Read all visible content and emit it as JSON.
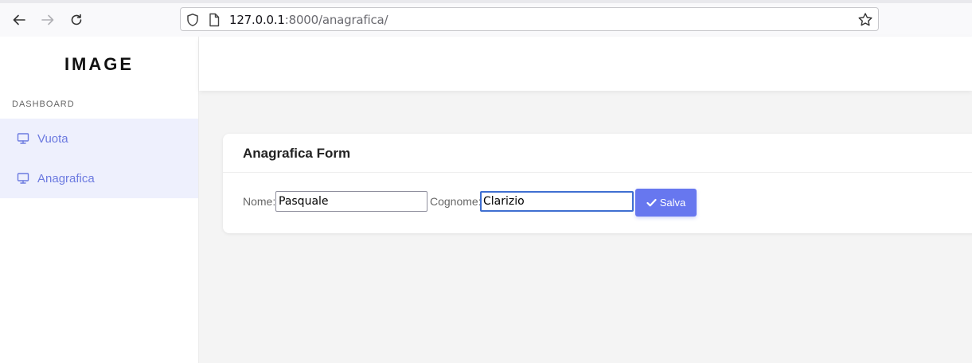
{
  "browser": {
    "url_host": "127.0.0.1",
    "url_rest": ":8000/anagrafica/"
  },
  "sidebar": {
    "brand": "IMAGE",
    "section_title": "DASHBOARD",
    "items": [
      {
        "label": "Vuota",
        "icon": "monitor-icon"
      },
      {
        "label": "Anagrafica",
        "icon": "monitor-icon"
      }
    ]
  },
  "form": {
    "title": "Anagrafica Form",
    "nome_label": "Nome:",
    "nome_value": "Pasquale",
    "cognome_label": "Cognome:",
    "cognome_value": "Clarizio",
    "save_label": "Salva"
  },
  "colors": {
    "accent": "#6777ef",
    "sidebar_link": "#6c7ae0",
    "sidebar_active_bg": "#eef0fd"
  }
}
